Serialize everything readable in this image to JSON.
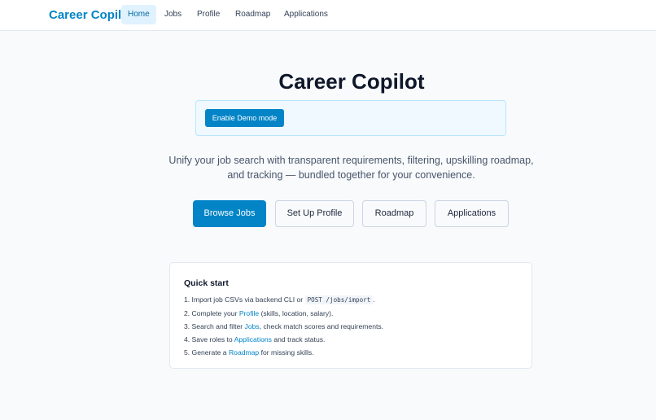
{
  "nav": {
    "brand": "Career Copilot",
    "items": [
      {
        "label": "Home",
        "active": true
      },
      {
        "label": "Jobs",
        "active": false
      },
      {
        "label": "Profile",
        "active": false
      },
      {
        "label": "Roadmap",
        "active": false
      },
      {
        "label": "Applications",
        "active": false
      }
    ]
  },
  "hero": {
    "title": "Career Copilot",
    "demo_button": "Enable Demo mode",
    "tagline_line1": "Unify your job search with transparent requirements, filtering, upskilling roadmap,",
    "tagline_line2": "and tracking — bundled together for your convenience."
  },
  "actions": {
    "browse_jobs": "Browse Jobs",
    "set_up_profile": "Set Up Profile",
    "roadmap": "Roadmap",
    "applications": "Applications"
  },
  "quick_start": {
    "title": "Quick start",
    "step1_prefix": "1. Import job CSVs via backend CLI or ",
    "step1_code": "POST /jobs/import",
    "step1_suffix": ".",
    "step2_prefix": "2. Complete your ",
    "step2_link": "Profile",
    "step2_suffix": " (skills, location, salary).",
    "step3_prefix": "3. Search and filter ",
    "step3_link": "Jobs",
    "step3_suffix": ", check match scores and requirements.",
    "step4_prefix": "4. Save roles to ",
    "step4_link": "Applications",
    "step4_suffix": " and track status.",
    "step5_prefix": "5. Generate a ",
    "step5_link": "Roadmap",
    "step5_suffix": " for missing skills."
  },
  "colors": {
    "accent": "#0284c7",
    "nav_active_bg": "#e0f2fe",
    "background": "#f8fafc"
  }
}
